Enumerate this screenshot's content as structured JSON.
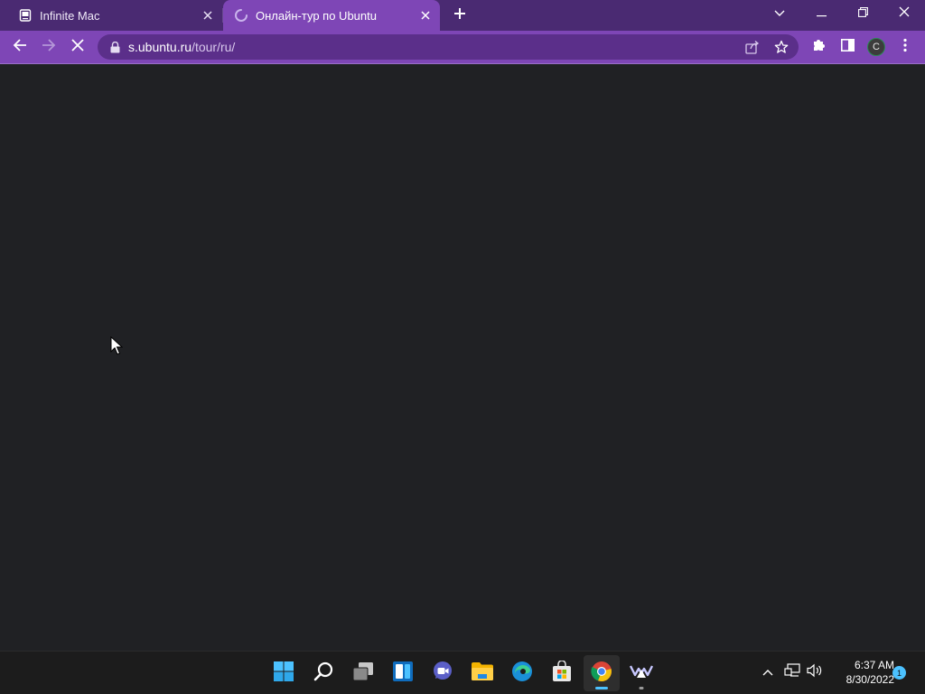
{
  "browser": {
    "tabs": [
      {
        "title": "Infinite Mac",
        "active": false,
        "favicon": "infinite-mac-favicon-icon"
      },
      {
        "title": "Онлайн-тур по Ubuntu",
        "active": true,
        "favicon": "loading-spinner-icon"
      }
    ],
    "new_tab": "new-tab-icon",
    "window_controls": [
      "tab-search-icon",
      "minimize-icon",
      "restore-icon",
      "close-icon"
    ],
    "toolbar": {
      "back": "back-arrow-icon",
      "forward": "forward-arrow-icon",
      "stop": "stop-loading-icon",
      "address": {
        "host": "s.ubuntu.ru",
        "path": "/tour/ru/",
        "secure_icon": "lock-icon"
      },
      "share": "share-icon",
      "bookmark": "star-icon",
      "extensions": "puzzle-icon",
      "side_panel": "side-panel-icon",
      "profile_initial": "C",
      "menu": "kebab-menu-icon"
    },
    "page": {
      "state": "loading",
      "background": "#202124"
    }
  },
  "taskbar": {
    "apps": [
      {
        "name": "start",
        "icon": "windows-start-icon",
        "running": false
      },
      {
        "name": "search",
        "icon": "search-icon",
        "running": false
      },
      {
        "name": "task-view",
        "icon": "task-view-icon",
        "running": false
      },
      {
        "name": "widgets",
        "icon": "widgets-icon",
        "running": false
      },
      {
        "name": "teams-chat",
        "icon": "chat-icon",
        "running": false
      },
      {
        "name": "file-explorer",
        "icon": "folder-icon",
        "running": false
      },
      {
        "name": "edge",
        "icon": "edge-icon",
        "running": false
      },
      {
        "name": "store",
        "icon": "store-icon",
        "running": false
      },
      {
        "name": "chrome",
        "icon": "chrome-icon",
        "running": true,
        "active": true
      },
      {
        "name": "app",
        "icon": "winamp-like-icon",
        "running": true,
        "active": false
      }
    ],
    "tray": {
      "overflow": "chevron-up-icon",
      "network": "network-icon",
      "volume": "speaker-icon",
      "time": "6:37 AM",
      "date": "8/30/2022",
      "notification_count": "1"
    }
  },
  "colors": {
    "tabstrip": "#4a2a72",
    "active_tab": "#7e46b6",
    "omnibox": "#5b2f8a",
    "page_bg": "#202124",
    "taskbar": "#1c1c1c",
    "accent": "#4cc2ff"
  }
}
